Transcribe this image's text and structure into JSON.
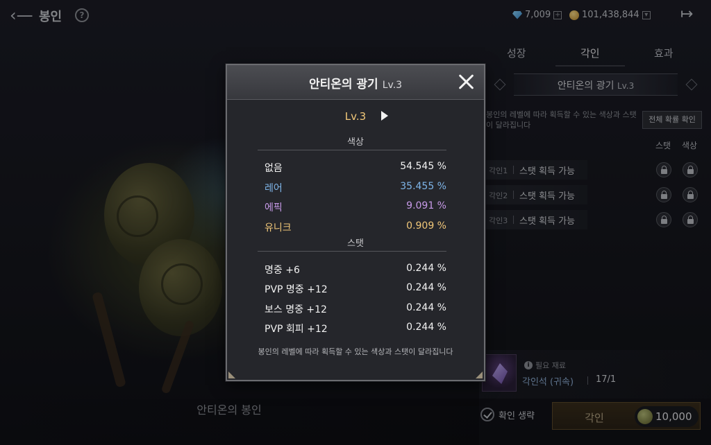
{
  "header": {
    "title": "봉인",
    "gem_count": "7,009",
    "gold_count": "101,438,844"
  },
  "tabs": [
    {
      "label": "성장"
    },
    {
      "label": "각인"
    },
    {
      "label": "효과"
    }
  ],
  "panel": {
    "name": "안티온의 광기",
    "level": "Lv.3",
    "description": "봉인의 레벨에 따라 획득할 수 있는 색상과 스탯이 달라집니다",
    "all_prob_button": "전체 확률 확인",
    "col_stat": "스탯",
    "col_color": "색상",
    "slots": [
      {
        "label": "각인1",
        "value": "스탯 획득 가능"
      },
      {
        "label": "각인2",
        "value": "스탯 획득 가능"
      },
      {
        "label": "각인3",
        "value": "스탯 획득 가능"
      }
    ],
    "material": {
      "need_label": "필요 재료",
      "name": "각인석 (귀속)",
      "count": "17/1"
    },
    "confirm_skip": "확인 생략",
    "engrave_label": "각인",
    "engrave_cost": "10,000"
  },
  "seal_name": "안티온의 봉인",
  "modal": {
    "title": "안티온의 광기",
    "title_level": "Lv.3",
    "level": "Lv.3",
    "color_section": "색상",
    "colors": [
      {
        "name": "없음",
        "pct": "54.545 %",
        "color": "#f2f2f2"
      },
      {
        "name": "레어",
        "pct": "35.455 %",
        "color": "#7fb6ea"
      },
      {
        "name": "에픽",
        "pct": "9.091 %",
        "color": "#c79ae8"
      },
      {
        "name": "유니크",
        "pct": "0.909 %",
        "color": "#f2c879"
      }
    ],
    "stat_section": "스탯",
    "stats": [
      {
        "name": "명중 +6",
        "pct": "0.244 %"
      },
      {
        "name": "PVP 명중 +12",
        "pct": "0.244 %"
      },
      {
        "name": "보스 명중 +12",
        "pct": "0.244 %"
      },
      {
        "name": "PVP 회피 +12",
        "pct": "0.244 %"
      }
    ],
    "footnote": "봉인의 레벨에 따라 획득할 수 있는 색상과 스탯이 달라집니다"
  }
}
